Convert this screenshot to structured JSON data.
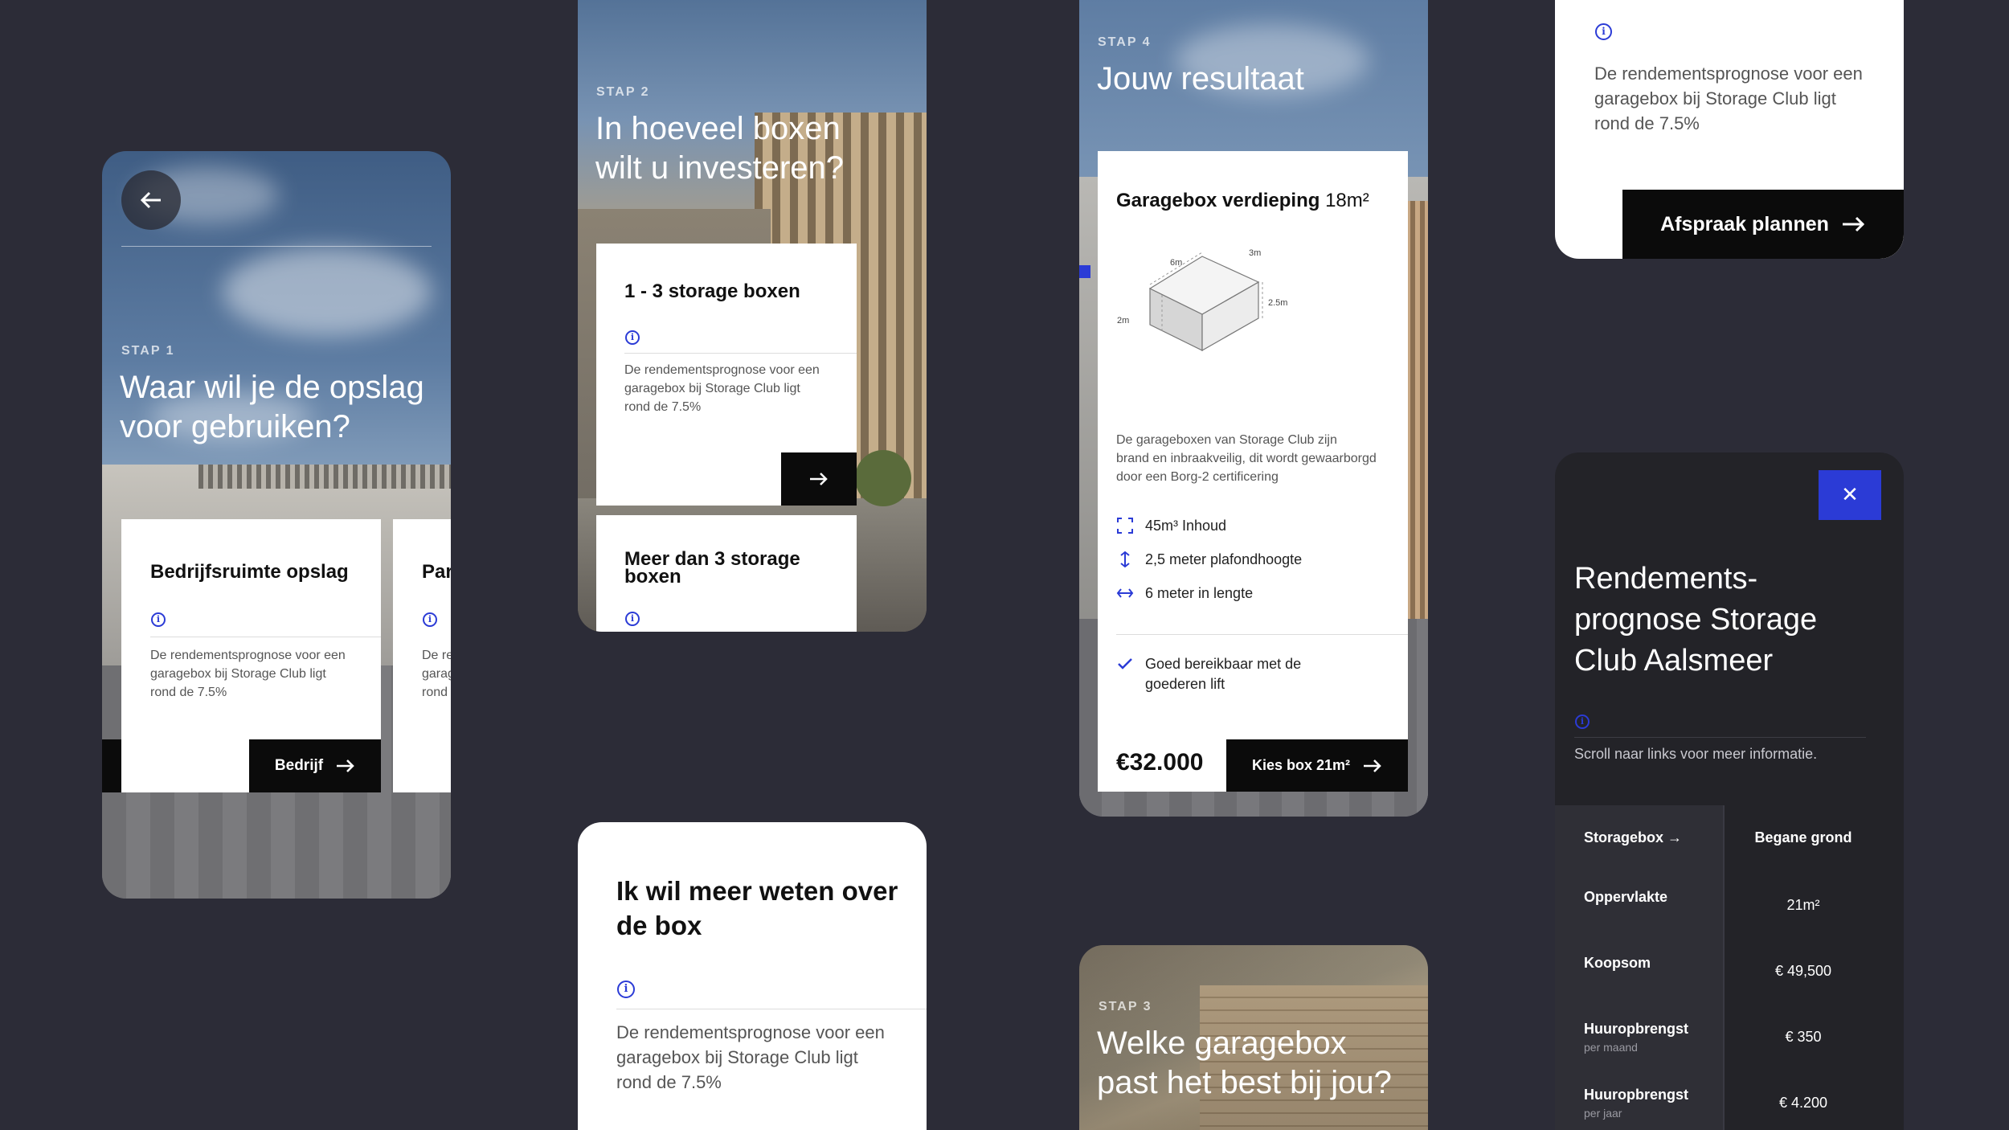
{
  "screen1": {
    "step": "STAP 1",
    "title_line1": "Waar wil je de opslag",
    "title_line2": "voor gebruiken?",
    "card": {
      "title": "Bedrijfsruimte opslag",
      "info_symbol": "i",
      "desc_line1": "De rendementsprognose voor een",
      "desc_line2": "garagebox bij Storage Club ligt",
      "desc_line3": "rond de 7.5%",
      "button": "Bedrijf"
    },
    "card2": {
      "title": "Par",
      "desc_line1": "De re",
      "desc_line2": "garag",
      "desc_line3": "rond"
    }
  },
  "screen2": {
    "step": "STAP 2",
    "title_line1": "In hoeveel boxen",
    "title_line2": "wilt u investeren?",
    "card1": {
      "title": "1 - 3 storage boxen",
      "desc_line1": "De rendementsprognose voor een",
      "desc_line2": "garagebox bij Storage Club ligt",
      "desc_line3": "rond de 7.5%"
    },
    "card2": {
      "title_line1": "Meer dan 3 storage",
      "title_line2": "boxen"
    }
  },
  "screen3": {
    "title_line1": "Ik wil meer weten over",
    "title_line2": "de box",
    "desc_line1": "De rendementsprognose voor een",
    "desc_line2": "garagebox bij Storage Club ligt",
    "desc_line3": "rond de 7.5%"
  },
  "screen4": {
    "step": "STAP 4",
    "title": "Jouw resultaat",
    "card": {
      "title": "Garagebox verdieping",
      "size": "18m²",
      "dims": {
        "d6": "6m",
        "d3": "3m",
        "d25": "2.5m",
        "d2": "2m"
      },
      "desc_line1": "De garageboxen van Storage Club zijn",
      "desc_line2": "brand en inbraakveilig, dit wordt gewaarborgd",
      "desc_line3": "door een Borg-2 certificering",
      "features": [
        {
          "icon": "expand-icon",
          "label": "45m³ Inhoud"
        },
        {
          "icon": "vertical-arrows-icon",
          "label": "2,5 meter plafondhoogte"
        },
        {
          "icon": "horizontal-arrows-icon",
          "label": "6 meter in lengte"
        }
      ],
      "check_line1": "Goed bereikbaar met de",
      "check_line2": "goederen lift",
      "price": "€32.000",
      "button": "Kies box 21m²"
    }
  },
  "screen5": {
    "step": "STAP 3",
    "title_line1": "Welke garagebox",
    "title_line2": "past het best bij jou?"
  },
  "screen6": {
    "desc_line1": "De rendementsprognose voor een",
    "desc_line2": "garagebox bij Storage Club ligt",
    "desc_line3": "rond de 7.5%",
    "button": "Afspraak plannen"
  },
  "screen7": {
    "close_symbol": "✕",
    "title_line1": "Rendements-",
    "title_line2": "prognose Storage",
    "title_line3": "Club Aalsmeer",
    "hint": "Scroll naar links voor meer informatie.",
    "table": {
      "header_label": "Storagebox →",
      "header_value": "Begane grond",
      "rows": [
        {
          "label": "Oppervlakte",
          "sub": "",
          "value": "21m²"
        },
        {
          "label": "Koopsom",
          "sub": "",
          "value": "€ 49,500"
        },
        {
          "label": "Huuropbrengst",
          "sub": "per maand",
          "value": "€ 350"
        },
        {
          "label": "Huuropbrengst",
          "sub": "per jaar",
          "value": "€ 4.200"
        }
      ]
    }
  },
  "colors": {
    "background": "#2c2c37",
    "accent": "#2b3bd6",
    "dark_panel": "#232328",
    "button": "#0b0b0b"
  }
}
